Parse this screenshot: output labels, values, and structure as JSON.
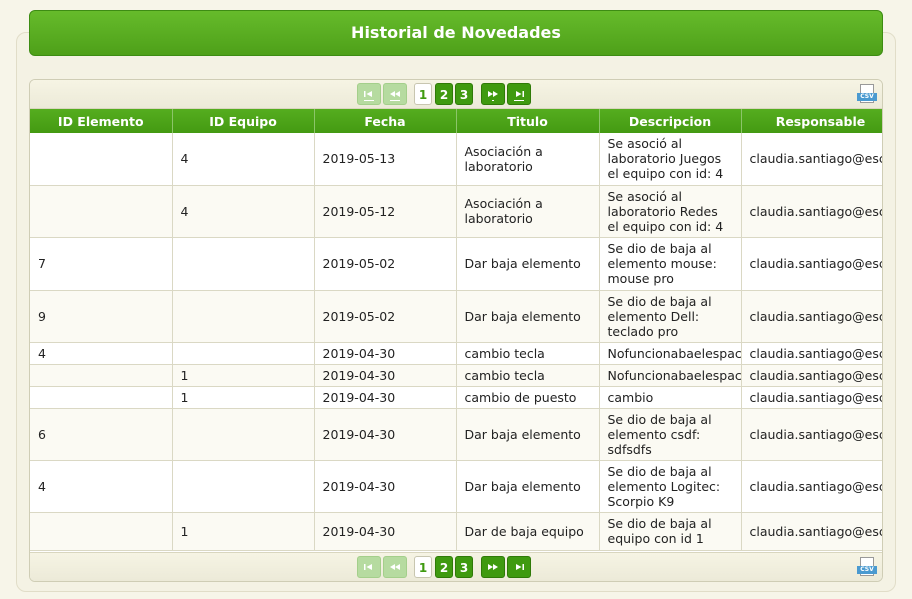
{
  "title": "Historial de Novedades",
  "pager": {
    "first_icon": "first-page-icon",
    "prev_icon": "prev-page-icon",
    "next_icon": "next-page-icon",
    "last_icon": "last-page-icon",
    "pages": [
      "1",
      "2",
      "3"
    ],
    "active_page": "1",
    "export_label": "CSV"
  },
  "table": {
    "columns": [
      "ID Elemento",
      "ID Equipo",
      "Fecha",
      "Titulo",
      "Descripcion",
      "Responsable"
    ],
    "rows": [
      [
        "",
        "4",
        "2019-05-13",
        "Asociación a laboratorio",
        "Se asoció al laboratorio Juegos el equipo con id: 4",
        "claudia.santiago@escue"
      ],
      [
        "",
        "4",
        "2019-05-12",
        "Asociación a laboratorio",
        "Se asoció al laboratorio Redes el equipo con id: 4",
        "claudia.santiago@escue"
      ],
      [
        "7",
        "",
        "2019-05-02",
        "Dar baja elemento",
        "Se dio de baja al elemento mouse: mouse pro",
        "claudia.santiago@escue"
      ],
      [
        "9",
        "",
        "2019-05-02",
        "Dar baja elemento",
        "Se dio de baja al elemento Dell: teclado pro",
        "claudia.santiago@escue"
      ],
      [
        "4",
        "",
        "2019-04-30",
        "cambio tecla",
        "Nofuncionabaelespacio",
        "claudia.santiago@escue"
      ],
      [
        "",
        "1",
        "2019-04-30",
        "cambio tecla",
        "Nofuncionabaelespacio",
        "claudia.santiago@escue"
      ],
      [
        "",
        "1",
        "2019-04-30",
        "cambio de puesto",
        "cambio",
        "claudia.santiago@escue"
      ],
      [
        "6",
        "",
        "2019-04-30",
        "Dar baja elemento",
        "Se dio de baja al elemento csdf: sdfsdfs",
        "claudia.santiago@escue"
      ],
      [
        "4",
        "",
        "2019-04-30",
        "Dar baja elemento",
        "Se dio de baja al elemento Logitec: Scorpio K9",
        "claudia.santiago@escue"
      ],
      [
        "",
        "1",
        "2019-04-30",
        "Dar de baja equipo",
        "Se dio de baja al equipo con id 1",
        "claudia.santiago@escue"
      ]
    ]
  },
  "colors": {
    "accent": "#4ea019",
    "header_text": "#ffffff",
    "background": "#f7f5e9"
  }
}
